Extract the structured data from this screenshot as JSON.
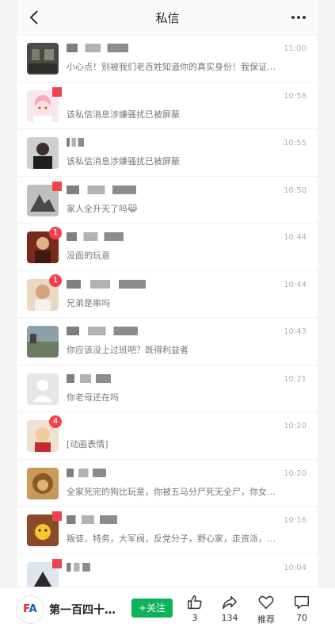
{
  "header": {
    "title": "私信",
    "back_icon": "chevron-left-icon",
    "more_icon": "more-dots-icon"
  },
  "conversations": [
    {
      "name": "",
      "message": "小心点！别被我们老百姓知道你的真实身份！我保证弄π你！",
      "time": "11:00",
      "badge": ""
    },
    {
      "name": "",
      "message": "该私信消息涉嫌骚扰已被屏蔽",
      "time": "10:58",
      "badge": ""
    },
    {
      "name": "",
      "message": "该私信消息涉嫌骚扰已被屏蔽",
      "time": "10:55",
      "badge": ""
    },
    {
      "name": "",
      "message": "家人全升天了吗😹",
      "time": "10:50",
      "badge": ""
    },
    {
      "name": "",
      "message": "没面的玩意",
      "time": "10:44",
      "badge": "1"
    },
    {
      "name": "",
      "message": "兄弟是串吗",
      "time": "10:44",
      "badge": "1"
    },
    {
      "name": "",
      "message": "你应该没上过班吧？既得利益者",
      "time": "10:43",
      "badge": ""
    },
    {
      "name": "",
      "message": "你老母还在吗",
      "time": "10:21",
      "badge": ""
    },
    {
      "name": "",
      "message": "[动画表情]",
      "time": "10:20",
      "badge": "4"
    },
    {
      "name": "",
      "message": "全家死完的狗比玩意，你被五马分尸死无全尸，你女儿以…",
      "time": "10:20",
      "badge": ""
    },
    {
      "name": "",
      "message": "叛徒，特务，大军阀，反党分子，野心家，走资派，投降…",
      "time": "10:16",
      "badge": ""
    },
    {
      "name": "",
      "message": "",
      "time": "10:04",
      "badge": ""
    }
  ],
  "bottom_bar": {
    "account_name": "第一百四十…",
    "follow_label": "+关注",
    "like_count": "3",
    "share_count": "134",
    "recommend_label": "推荐",
    "comment_count": "70"
  },
  "colors": {
    "accent_red": "#f0434c",
    "follow_green": "#0bb45a"
  }
}
